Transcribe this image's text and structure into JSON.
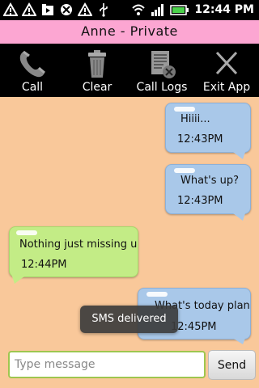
{
  "status_bar": {
    "time": "12:44 PM",
    "icons": [
      "warning-icon",
      "warning-icon",
      "media-icon",
      "missed-call-icon",
      "warning-icon",
      "usb-icon",
      "wifi-icon",
      "signal-icon",
      "battery-icon"
    ]
  },
  "header": {
    "title": "Anne   -   Private"
  },
  "toolbar": {
    "items": [
      {
        "label": "Call",
        "icon": "phone-icon"
      },
      {
        "label": "Clear",
        "icon": "trash-icon"
      },
      {
        "label": "Call Logs",
        "icon": "call-logs-icon"
      },
      {
        "label": "Exit App",
        "icon": "close-icon"
      }
    ]
  },
  "messages": [
    {
      "direction": "outgoing",
      "text": "Hiiii...",
      "time": "12:43PM"
    },
    {
      "direction": "outgoing",
      "text": "What's up?",
      "time": "12:43PM"
    },
    {
      "direction": "incoming",
      "text": "Nothing just missing u",
      "time": "12:44PM"
    },
    {
      "direction": "outgoing",
      "text": "What's today plan",
      "time": "12:45PM"
    }
  ],
  "toast": {
    "text": "SMS delivered"
  },
  "composer": {
    "placeholder": "Type message",
    "send_label": "Send"
  },
  "colors": {
    "title_bg": "#fca6d2",
    "chat_bg": "#f9c89a",
    "outgoing_bubble": "#a9c8e9",
    "incoming_bubble": "#c3ec86"
  }
}
